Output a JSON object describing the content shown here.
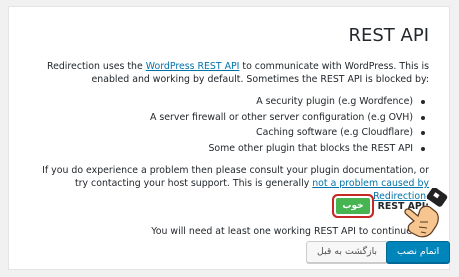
{
  "title": "REST API",
  "intro": {
    "before": "Redirection uses the ",
    "link": "WordPress REST API",
    "after": " to communicate with WordPress. This is enabled and working by default. Sometimes the REST API is blocked by:"
  },
  "causes": [
    "A security plugin (e.g Wordfence)",
    "A server firewall or other server configuration (e.g OVH)",
    "Caching software (e.g Cloudflare)",
    "Some other plugin that blocks the REST API"
  ],
  "help": {
    "before": "If you do experience a problem then please consult your plugin documentation, or try contacting your host support. This is generally ",
    "link": "not a problem caused by Redirection",
    "after": "."
  },
  "rest_api": {
    "label": "REST API:",
    "status": "خوب"
  },
  "requirement": "You will need at least one working REST API to continue.",
  "buttons": {
    "back": "بازگشت به قبل",
    "finish": "اتمام نصب"
  },
  "colors": {
    "link": "#0073aa",
    "badge": "#46b450",
    "highlight": "#c62828",
    "primary": "#0085ba"
  },
  "icons": {
    "pointer": "hand-pointer-icon"
  }
}
